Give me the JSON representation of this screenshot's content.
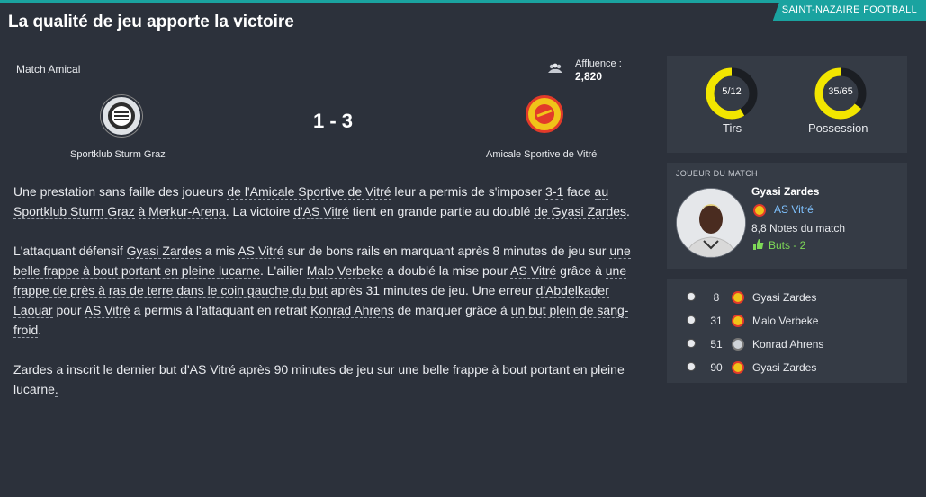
{
  "header": {
    "title": "La qualité de jeu apporte la victoire",
    "club_tag": "SAINT-NAZAIRE FOOTBALL"
  },
  "match": {
    "type": "Match Amical",
    "attendance_label": "Affluence :",
    "attendance_value": "2,820",
    "score": "1 - 3",
    "home_team": "Sportklub Sturm Graz",
    "away_team": "Amicale Sportive de Vitré"
  },
  "report": {
    "p1": [
      "Une prestation sans faille des joueurs ",
      "de l'Amicale Sportive de Vitré",
      " leur a permis de s'imposer ",
      "3-1",
      " face ",
      "au Sportklub Sturm Graz",
      " ",
      "à Merkur-Arena",
      ". La victoire ",
      "d'AS Vitré",
      " tient en grande partie au doublé ",
      "de Gyasi Zardes",
      "."
    ],
    "p2": [
      "L'attaquant défensif ",
      "Gyasi Zardes",
      " a mis ",
      "AS Vitré",
      " sur de bons rails en marquant après 8 minutes de jeu sur ",
      "une belle frappe à bout portant en pleine lucarne",
      ". L'ailier ",
      "Malo Verbeke",
      " a doublé la mise pour ",
      "AS Vitré",
      " grâce à ",
      "une frappe de près à ras de terre dans le coin gauche du but",
      " après 31 minutes de jeu. Une erreur ",
      "d'Abdelkader Laouar",
      " pour ",
      "AS Vitré",
      " a permis à l'attaquant en retrait ",
      "Konrad Ahrens",
      " de marquer grâce à ",
      "un but plein de sang-froid",
      "."
    ],
    "p3": [
      "Zardes",
      " a inscrit le dernier but ",
      "d'AS Vitré",
      " après 90 minutes de jeu sur ",
      "une belle frappe à bout portant en pleine lucarne",
      "."
    ]
  },
  "stats": {
    "shots": {
      "value": "5/12",
      "label": "Tirs",
      "fraction": 0.4167
    },
    "possession": {
      "value": "35/65",
      "label": "Possession",
      "fraction": 0.35
    },
    "accent_color": "#f2e600"
  },
  "motm": {
    "heading": "JOUEUR DU MATCH",
    "name": "Gyasi Zardes",
    "club": "AS Vitré",
    "rating": "8,8 Notes du match",
    "goals": "Buts - 2"
  },
  "goals": [
    {
      "minute": "8",
      "scorer": "Gyasi Zardes",
      "team": "away"
    },
    {
      "minute": "31",
      "scorer": "Malo Verbeke",
      "team": "away"
    },
    {
      "minute": "51",
      "scorer": "Konrad Ahrens",
      "team": "home"
    },
    {
      "minute": "90",
      "scorer": "Gyasi Zardes",
      "team": "away"
    }
  ]
}
